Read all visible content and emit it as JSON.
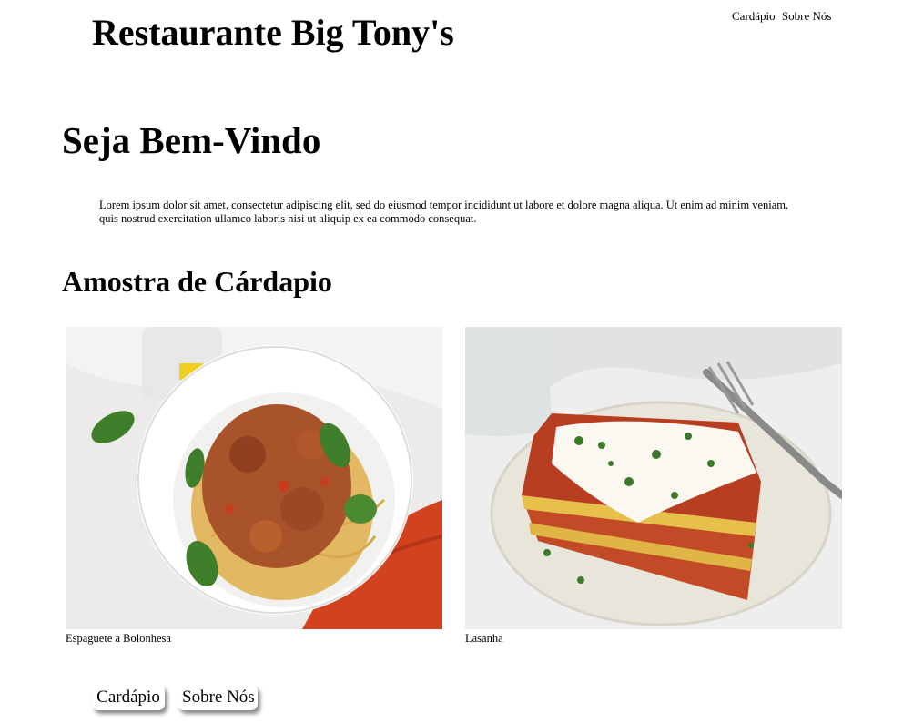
{
  "header": {
    "title": "Restaurante Big Tony's",
    "nav": [
      "Cardápio",
      "Sobre Nós"
    ]
  },
  "welcome": {
    "heading": "Seja Bem-Vindo",
    "text": "Lorem ipsum dolor sit amet, consectetur adipiscing elit, sed do eiusmod tempor incididunt ut labore et dolore magna aliqua. Ut enim ad minim veniam, quis nostrud exercitation ullamco laboris nisi ut aliquip ex ea commodo consequat."
  },
  "menu": {
    "heading": "Amostra de Cárdapio",
    "items": [
      {
        "caption": "Espaguete a Bolonhesa",
        "image": "spaghetti-bolognese-photo"
      },
      {
        "caption": "Lasanha",
        "image": "lasagna-photo"
      }
    ]
  },
  "footer": {
    "buttons": [
      "Cardápio",
      "Sobre Nós"
    ]
  }
}
